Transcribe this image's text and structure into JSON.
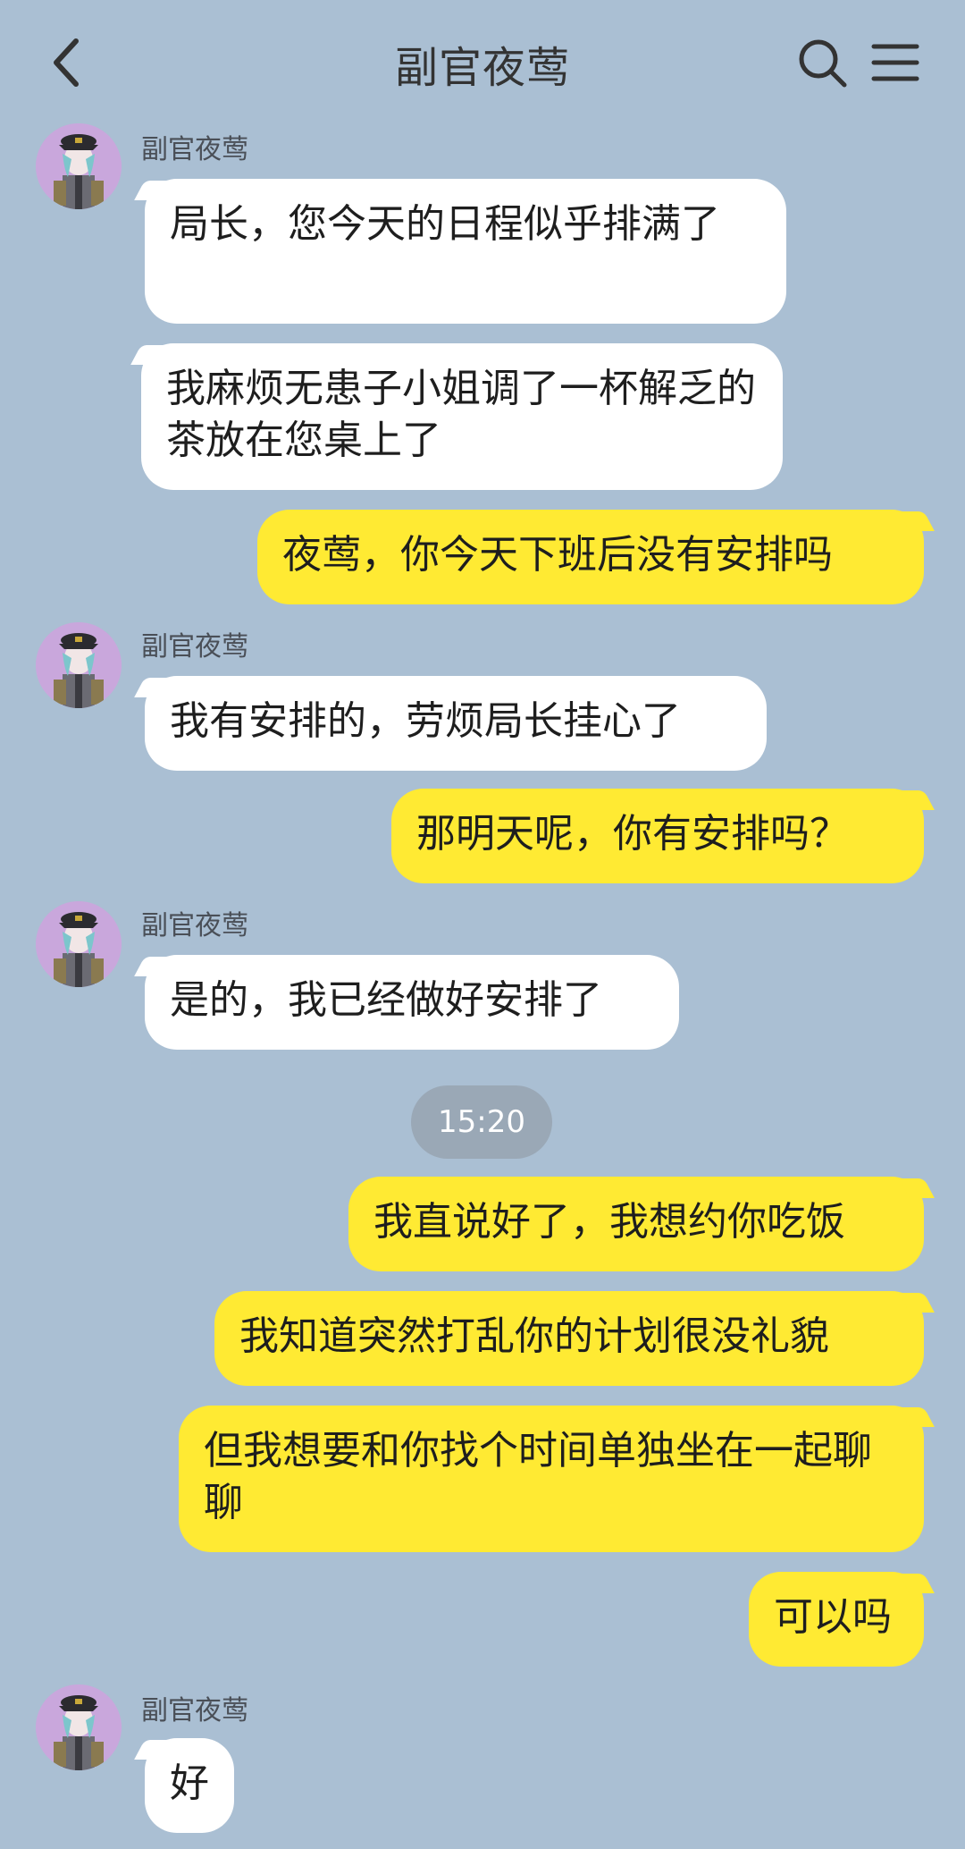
{
  "header": {
    "title": "副官夜莺"
  },
  "contact": {
    "name": "副官夜莺"
  },
  "messages": [
    {
      "side": "in",
      "text": "局长，您今天的日程似乎排满了"
    },
    {
      "side": "in",
      "text": "我麻烦无患子小姐调了一杯解乏的茶放在您桌上了"
    },
    {
      "side": "out",
      "text": "夜莺，你今天下班后没有安排吗"
    },
    {
      "side": "in",
      "text": "我有安排的，劳烦局长挂心了"
    },
    {
      "side": "out",
      "text": "那明天呢，你有安排吗？"
    },
    {
      "side": "in",
      "text": "是的，我已经做好安排了"
    },
    {
      "side": "time",
      "text": "15:20"
    },
    {
      "side": "out",
      "text": "我直说好了，我想约你吃饭"
    },
    {
      "side": "out",
      "text": "我知道突然打乱你的计划很没礼貌"
    },
    {
      "side": "out",
      "text": "但我想要和你找个时间单独坐在一起聊聊"
    },
    {
      "side": "out",
      "text": "可以吗"
    },
    {
      "side": "in",
      "text": "好"
    }
  ],
  "colors": {
    "background": "#aabfd3",
    "incoming_bubble": "#ffffff",
    "outgoing_bubble": "#ffea33",
    "time_chip": "#9aa8b6"
  },
  "icons": {
    "back": "chevron-left-icon",
    "search": "search-icon",
    "menu": "menu-icon",
    "avatar": "avatar"
  }
}
